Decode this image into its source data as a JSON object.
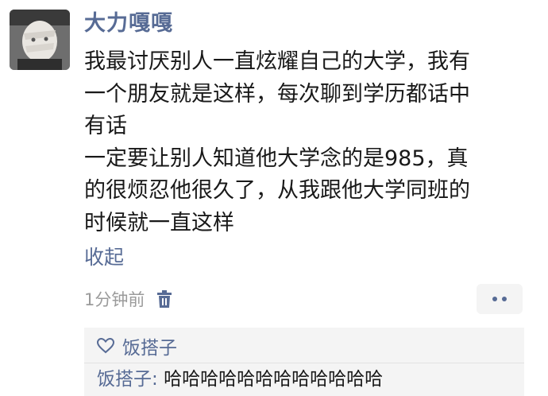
{
  "post": {
    "author": "大力嘎嘎",
    "content_lines": [
      "我最讨厌别人一直炫耀自己的大学，我有",
      "一个朋友就是这样，每次聊到学历都话中",
      "有话",
      "一定要让别人知道他大学念的是985，真",
      "的很烦忍他很久了，从我跟他大学同班的",
      "时候就一直这样"
    ],
    "collapse_label": "收起",
    "time": "1分钟前",
    "icons": {
      "delete": "trash-icon",
      "more": "more-dots-icon",
      "like": "heart-icon"
    }
  },
  "likes": {
    "names": "饭搭子"
  },
  "comments": [
    {
      "author": "饭搭子",
      "separator": ": ",
      "text": "哈哈哈哈哈哈哈哈哈哈哈哈"
    }
  ],
  "colors": {
    "link": "#576b95",
    "text": "#191919",
    "meta": "#9b9b9b",
    "panel": "#f4f4f4"
  }
}
